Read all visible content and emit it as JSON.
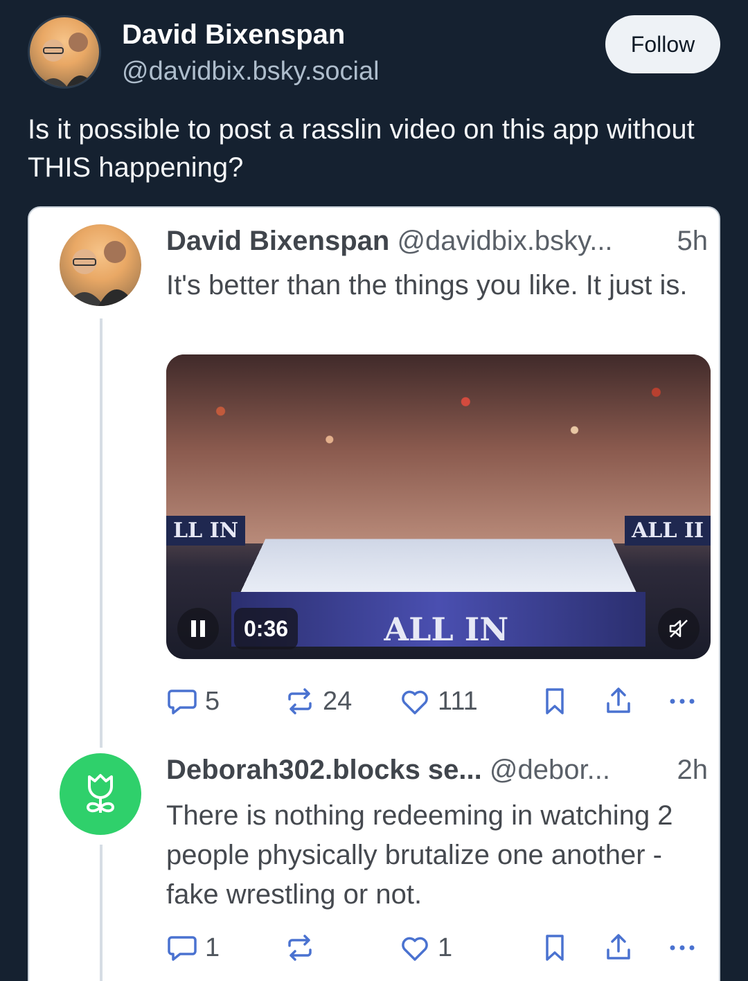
{
  "post": {
    "author_name": "David Bixenspan",
    "author_handle": "@davidbix.bsky.social",
    "follow_label": "Follow",
    "text": "Is it possible to post a rasslin video on this app without THIS happening?"
  },
  "embed": {
    "replies": [
      {
        "name": "David Bixenspan",
        "handle": "@davidbix.bsky...",
        "time": "5h",
        "text": "It's better than the things you like. It just is.",
        "video": {
          "time": "0:36",
          "banner_left": "LL IN",
          "banner_right": "ALL II",
          "apron_text": "ALL IN"
        },
        "reply_count": "5",
        "repost_count": "24",
        "like_count": "111"
      },
      {
        "name": "Deborah302.blocks se...",
        "handle": "@debor...",
        "time": "2h",
        "text": "There is nothing redeeming in watching 2 people physically brutalize one another - fake wrestling or not.",
        "reply_count": "1",
        "repost_count": "",
        "like_count": "1"
      }
    ]
  },
  "colors": {
    "background": "#152130",
    "follow_bg": "#eef2f6",
    "avatar_green": "#2fd06b"
  }
}
